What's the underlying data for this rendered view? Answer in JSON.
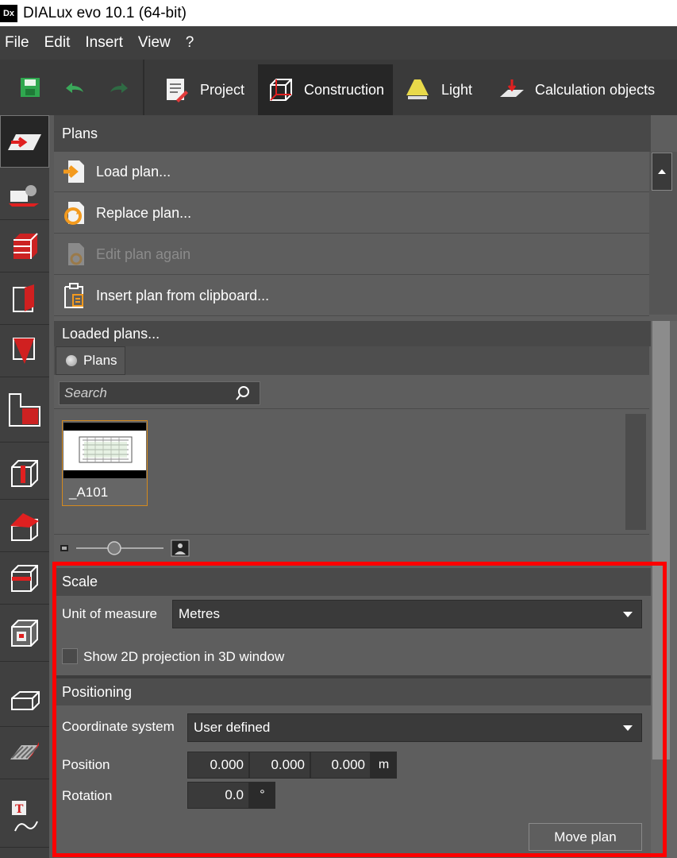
{
  "window": {
    "logo_text": "Dx",
    "title": "DIALux evo 10.1  (64-bit)"
  },
  "menu": {
    "items": [
      "File",
      "Edit",
      "Insert",
      "View",
      "?"
    ]
  },
  "toolbar": {
    "tabs": [
      {
        "label": "Project",
        "icon": "project-icon"
      },
      {
        "label": "Construction",
        "icon": "construction-cube-icon",
        "active": true
      },
      {
        "label": "Light",
        "icon": "light-lamp-icon"
      },
      {
        "label": "Calculation objects",
        "icon": "calculation-objects-icon"
      }
    ]
  },
  "plans": {
    "header": "Plans",
    "actions": [
      {
        "label": "Load plan...",
        "enabled": true
      },
      {
        "label": "Replace plan...",
        "enabled": true
      },
      {
        "label": "Edit plan again",
        "enabled": false
      },
      {
        "label": "Insert plan from clipboard...",
        "enabled": true
      }
    ]
  },
  "loaded": {
    "header": "Loaded plans...",
    "tab_label": "Plans",
    "search_placeholder": "Search",
    "items": [
      {
        "name": "_A101"
      }
    ]
  },
  "scale": {
    "header": "Scale",
    "unit_label": "Unit of measure",
    "unit_value": "Metres",
    "projection_label": "Show 2D projection in 3D window",
    "projection_checked": false
  },
  "positioning": {
    "header": "Positioning",
    "coord_label": "Coordinate system",
    "coord_value": "User defined",
    "position_label": "Position",
    "position_x": "0.000",
    "position_y": "0.000",
    "position_z": "0.000",
    "position_unit": "m",
    "rotation_label": "Rotation",
    "rotation_value": "0.0",
    "rotation_unit": "°",
    "move_label": "Move plan"
  },
  "colors": {
    "accent_red": "#ff0000",
    "active_tab_bg": "#262626",
    "selection_orange": "#d48a1e"
  }
}
